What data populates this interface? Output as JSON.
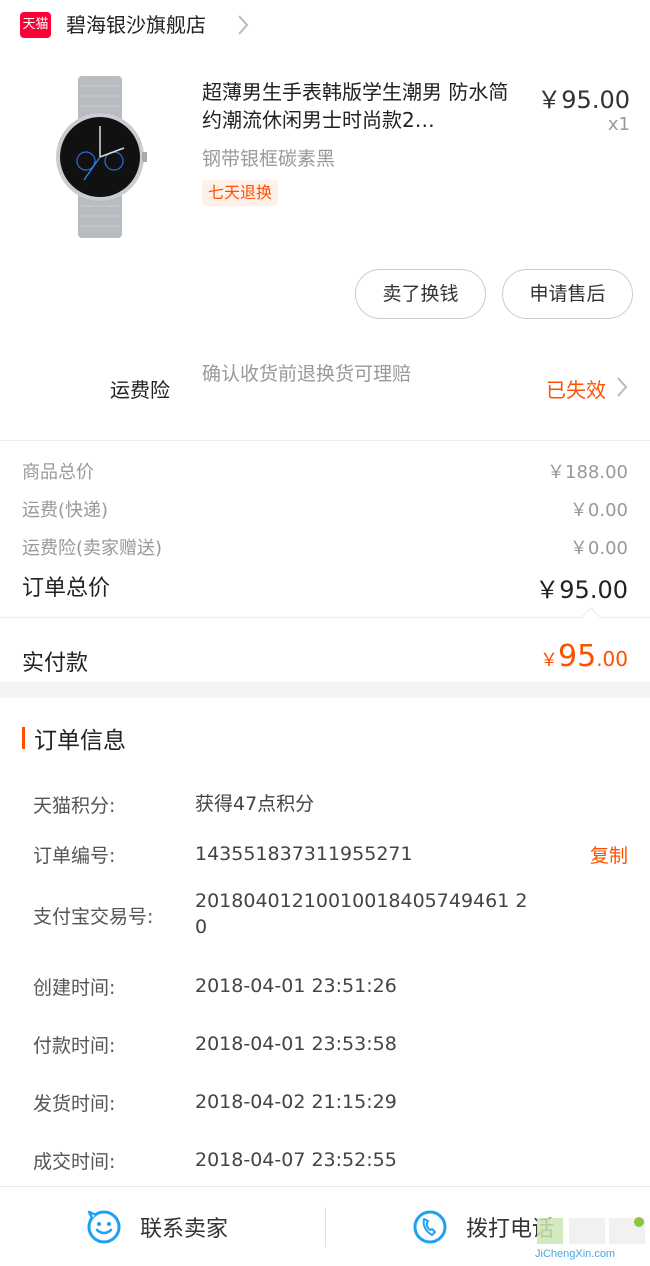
{
  "shop": {
    "logo_text": "天猫",
    "name": "碧海银沙旗舰店"
  },
  "product": {
    "title": "超薄男生手表韩版学生潮男 防水简约潮流休闲男士时尚款2…",
    "price": "￥95.00",
    "quantity": "x1",
    "sku": "钢带银框碳素黑",
    "badge": "七天退换"
  },
  "actions": {
    "sell_label": "卖了换钱",
    "after_sale_label": "申请售后"
  },
  "shipping_insurance": {
    "label": "运费险",
    "description": "确认收货前退换货可理赔",
    "status": "已失效"
  },
  "summary": {
    "rows": [
      {
        "label": "商品总价",
        "value": "￥188.00"
      },
      {
        "label": "运费(快递)",
        "value": "￥0.00"
      },
      {
        "label": "运费险(卖家赠送)",
        "value": "￥0.00"
      }
    ],
    "order_total_label": "订单总价",
    "order_total_value": "￥95.00",
    "paid_label": "实付款",
    "paid_currency": "￥",
    "paid_int": "95",
    "paid_dec": ".00"
  },
  "order_info": {
    "title": "订单信息",
    "copy_label": "复制",
    "rows": [
      {
        "key": "天猫积分:",
        "value": "获得47点积分"
      },
      {
        "key": "订单编号:",
        "value": "143551837311955271"
      },
      {
        "key": "支付宝交易号:",
        "value": "20180401210010018405749461 20"
      },
      {
        "key": "创建时间:",
        "value": "2018-04-01 23:51:26"
      },
      {
        "key": "付款时间:",
        "value": "2018-04-01 23:53:58"
      },
      {
        "key": "发货时间:",
        "value": "2018-04-02 21:15:29"
      },
      {
        "key": "成交时间:",
        "value": "2018-04-07 23:52:55"
      }
    ]
  },
  "bottom_bar": {
    "contact_label": "联系卖家",
    "call_label": "拨打电话"
  },
  "watermark": {
    "text": "JiChengXin.com"
  },
  "colors": {
    "accent": "#ff5000",
    "tmall_red": "#ff0036",
    "icon_blue": "#1ea1f3"
  }
}
